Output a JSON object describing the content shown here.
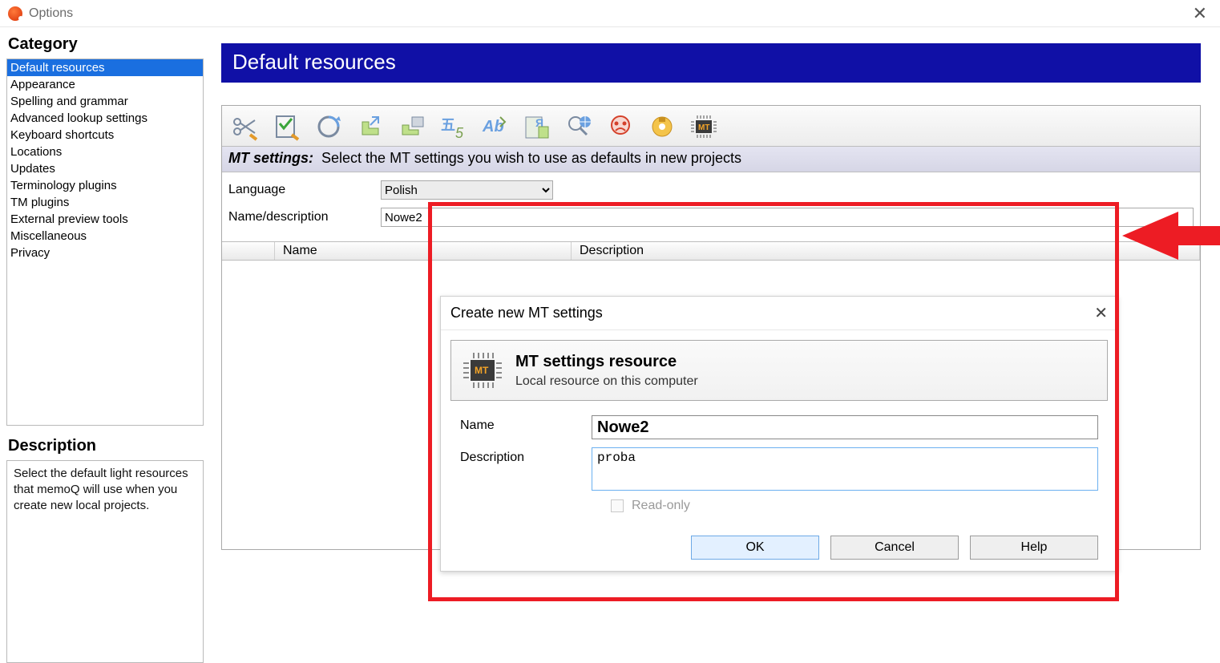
{
  "window": {
    "title": "Options"
  },
  "sidebar": {
    "heading": "Category",
    "items": [
      {
        "label": "Default resources",
        "selected": true
      },
      {
        "label": "Appearance"
      },
      {
        "label": "Spelling and grammar"
      },
      {
        "label": "Advanced lookup settings"
      },
      {
        "label": "Keyboard shortcuts"
      },
      {
        "label": "Locations"
      },
      {
        "label": "Updates"
      },
      {
        "label": "Terminology plugins"
      },
      {
        "label": "TM plugins"
      },
      {
        "label": "External preview tools"
      },
      {
        "label": "Miscellaneous"
      },
      {
        "label": "Privacy"
      }
    ],
    "description_heading": "Description",
    "description_text": "Select the default light resources that memoQ will use when you create new local projects."
  },
  "page": {
    "title": "Default resources"
  },
  "mt_bar": {
    "label": "MT settings:",
    "text": "Select the MT settings you wish to use as defaults in new projects"
  },
  "filters": {
    "language_label": "Language",
    "language_value": "Polish",
    "name_label": "Name/description",
    "name_value": "Nowe2"
  },
  "grid": {
    "col_name": "Name",
    "col_description": "Description"
  },
  "dialog": {
    "title": "Create new MT settings",
    "info_title": "MT settings resource",
    "info_sub": "Local resource on this computer",
    "name_label": "Name",
    "name_value": "Nowe2",
    "description_label": "Description",
    "description_value": "proba",
    "readonly_label": "Read-only",
    "ok": "OK",
    "cancel": "Cancel",
    "help": "Help"
  },
  "toolbar_icons": [
    "segmentation-rules-icon",
    "qa-settings-icon",
    "tm-settings-icon",
    "export-path-rules-icon",
    "auto-translation-rules-icon",
    "non-translatables-icon",
    "autocorrect-icon",
    "filter-config-icon",
    "web-search-icon",
    "ignore-lists-icon",
    "livedocs-icon",
    "mt-settings-icon"
  ]
}
